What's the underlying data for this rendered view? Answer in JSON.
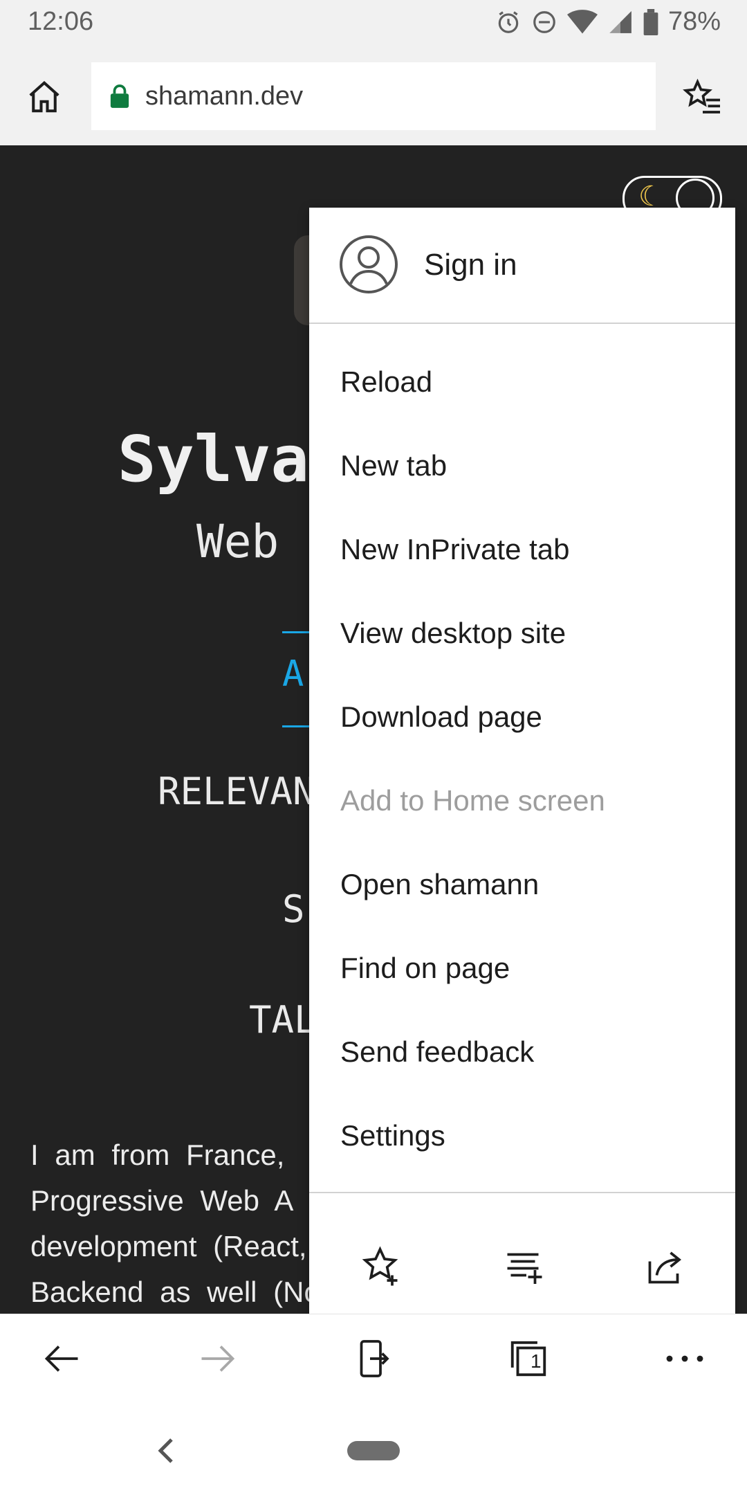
{
  "status": {
    "time": "12:06",
    "battery": "78%"
  },
  "browser": {
    "url": "shamann.dev"
  },
  "page": {
    "name_partial": "Sylva",
    "subtitle_partial": "Web",
    "accent_partial": "A",
    "nav_relevant": "RELEVAN",
    "nav_s": "S",
    "nav_tal": "TAL",
    "bio_lines": [
      "I am from France,",
      "Progressive Web A",
      "development (React,",
      "Backend as well (No"
    ]
  },
  "menu": {
    "sign_in": "Sign in",
    "items": [
      {
        "label": "Reload",
        "disabled": false
      },
      {
        "label": "New tab",
        "disabled": false
      },
      {
        "label": "New InPrivate tab",
        "disabled": false
      },
      {
        "label": "View desktop site",
        "disabled": false
      },
      {
        "label": "Download page",
        "disabled": false
      },
      {
        "label": "Add to Home screen",
        "disabled": true
      },
      {
        "label": "Open shamann",
        "disabled": false
      },
      {
        "label": "Find on page",
        "disabled": false
      },
      {
        "label": "Send feedback",
        "disabled": false
      },
      {
        "label": "Settings",
        "disabled": false
      }
    ]
  },
  "toolbar": {
    "tab_count": "1"
  },
  "colors": {
    "page_bg": "#222222",
    "accent": "#1aa7e6",
    "lock": "#0f7b3f"
  }
}
